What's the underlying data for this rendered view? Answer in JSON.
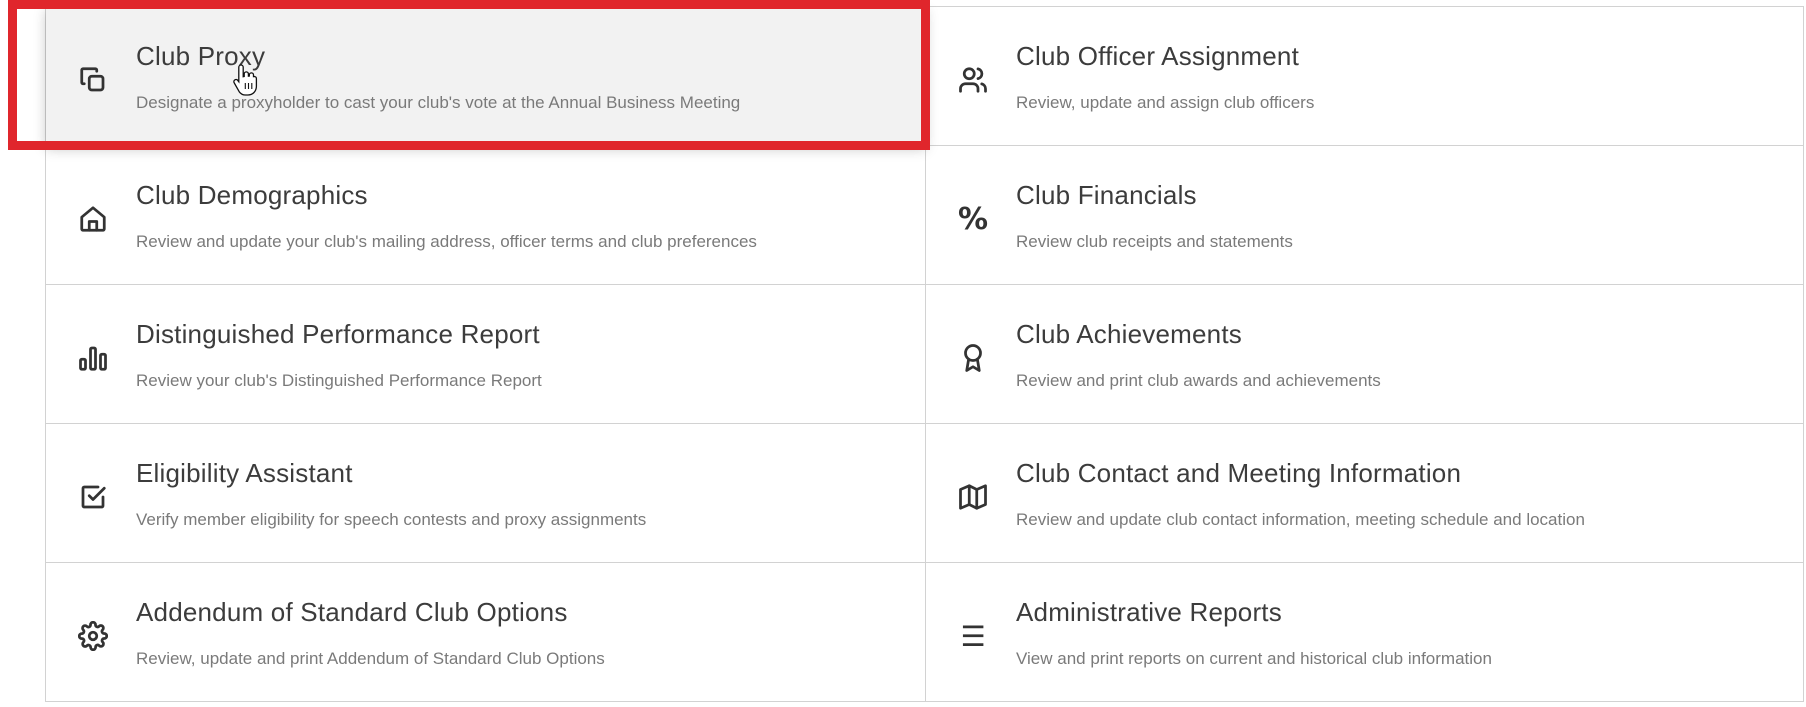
{
  "tiles": [
    {
      "title": "Club Proxy",
      "desc": "Designate a proxyholder to cast your club's vote at the Annual Business Meeting",
      "icon": "copy-icon"
    },
    {
      "title": "Club Officer Assignment",
      "desc": "Review, update and assign club officers",
      "icon": "users-icon"
    },
    {
      "title": "Club Demographics",
      "desc": "Review and update your club's mailing address, officer terms and club preferences",
      "icon": "home-icon"
    },
    {
      "title": "Club Financials",
      "desc": "Review club receipts and statements",
      "icon": "percent-icon"
    },
    {
      "title": "Distinguished Performance Report",
      "desc": "Review your club's Distinguished Performance Report",
      "icon": "bar-chart-icon"
    },
    {
      "title": "Club Achievements",
      "desc": "Review and print club awards and achievements",
      "icon": "award-icon"
    },
    {
      "title": "Eligibility Assistant",
      "desc": "Verify member eligibility for speech contests and proxy assignments",
      "icon": "checkbox-icon"
    },
    {
      "title": "Club Contact and Meeting Information",
      "desc": "Review and update club contact information, meeting schedule and location",
      "icon": "map-icon"
    },
    {
      "title": "Addendum of Standard Club Options",
      "desc": "Review, update and print Addendum of Standard Club Options",
      "icon": "gear-icon"
    },
    {
      "title": "Administrative Reports",
      "desc": "View and print reports on current and historical club information",
      "icon": "menu-icon"
    }
  ],
  "highlight_color": "#e0262c",
  "percent_glyph": "%",
  "menu_glyph": "☰"
}
